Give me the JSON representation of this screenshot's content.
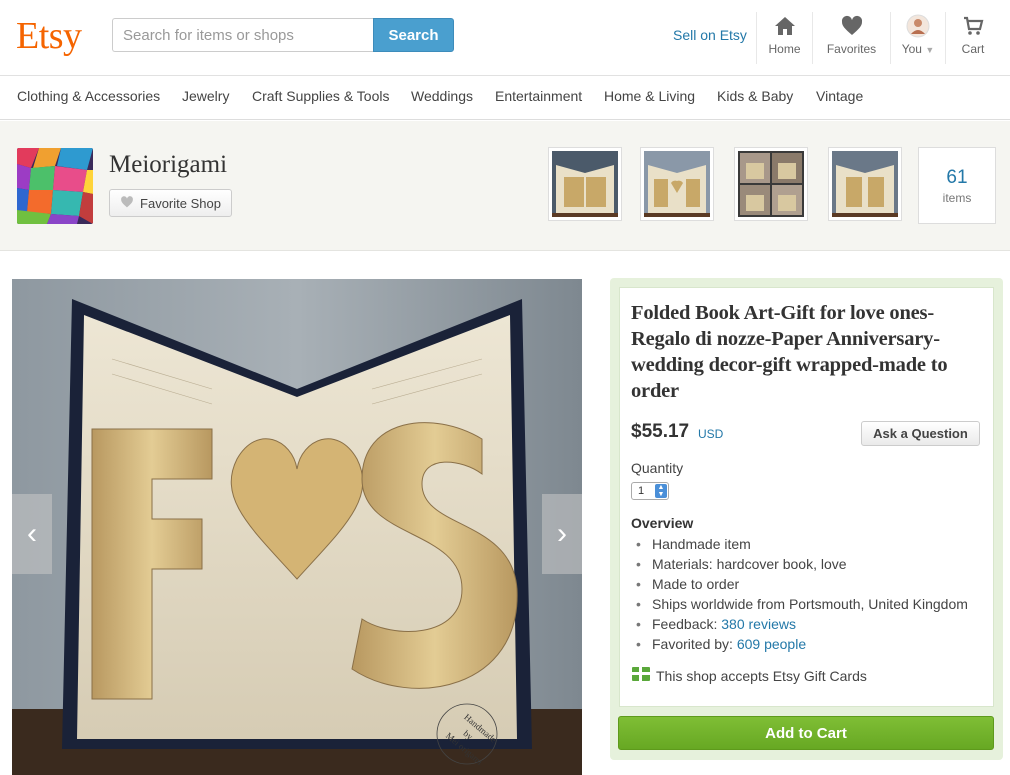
{
  "header": {
    "logo": "Etsy",
    "search_placeholder": "Search for items or shops",
    "search_button": "Search",
    "sell_link": "Sell on Etsy",
    "nav": [
      {
        "label": "Home",
        "icon": "home-icon"
      },
      {
        "label": "Favorites",
        "icon": "heart-icon"
      },
      {
        "label": "You",
        "icon": "avatar"
      },
      {
        "label": "Cart",
        "icon": "cart-icon"
      }
    ]
  },
  "categories": [
    "Clothing & Accessories",
    "Jewelry",
    "Craft Supplies & Tools",
    "Weddings",
    "Entertainment",
    "Home & Living",
    "Kids & Baby",
    "Vintage"
  ],
  "shop": {
    "name": "Meiorigami",
    "favorite_button": "Favorite Shop",
    "item_count": "61",
    "item_count_label": "items"
  },
  "listing": {
    "title": "Folded Book Art-Gift for love ones-Regalo di nozze-Paper Anniversary-wedding decor-gift wrapped-made to order",
    "price": "$55.17",
    "currency": "USD",
    "ask_button": "Ask a Question",
    "quantity_label": "Quantity",
    "quantity_value": "1",
    "overview_heading": "Overview",
    "overview": {
      "item1": "Handmade item",
      "item2": "Materials: hardcover book, love",
      "item3": "Made to order",
      "item4": "Ships worldwide from Portsmouth, United Kingdom",
      "feedback_prefix": "Feedback: ",
      "feedback_link": "380 reviews",
      "favorited_prefix": "Favorited by: ",
      "favorited_link": "609 people"
    },
    "gift_cards": "This shop accepts Etsy Gift Cards",
    "add_to_cart": "Add to Cart",
    "image_stamp": [
      "Handmade",
      "by",
      "Mei origami"
    ]
  },
  "colors": {
    "brand": "#f56400",
    "link": "#2378a8",
    "search_button": "#4a9fcf",
    "add_to_cart": "#6fb22a",
    "panel_bg": "#e6f1dc"
  }
}
